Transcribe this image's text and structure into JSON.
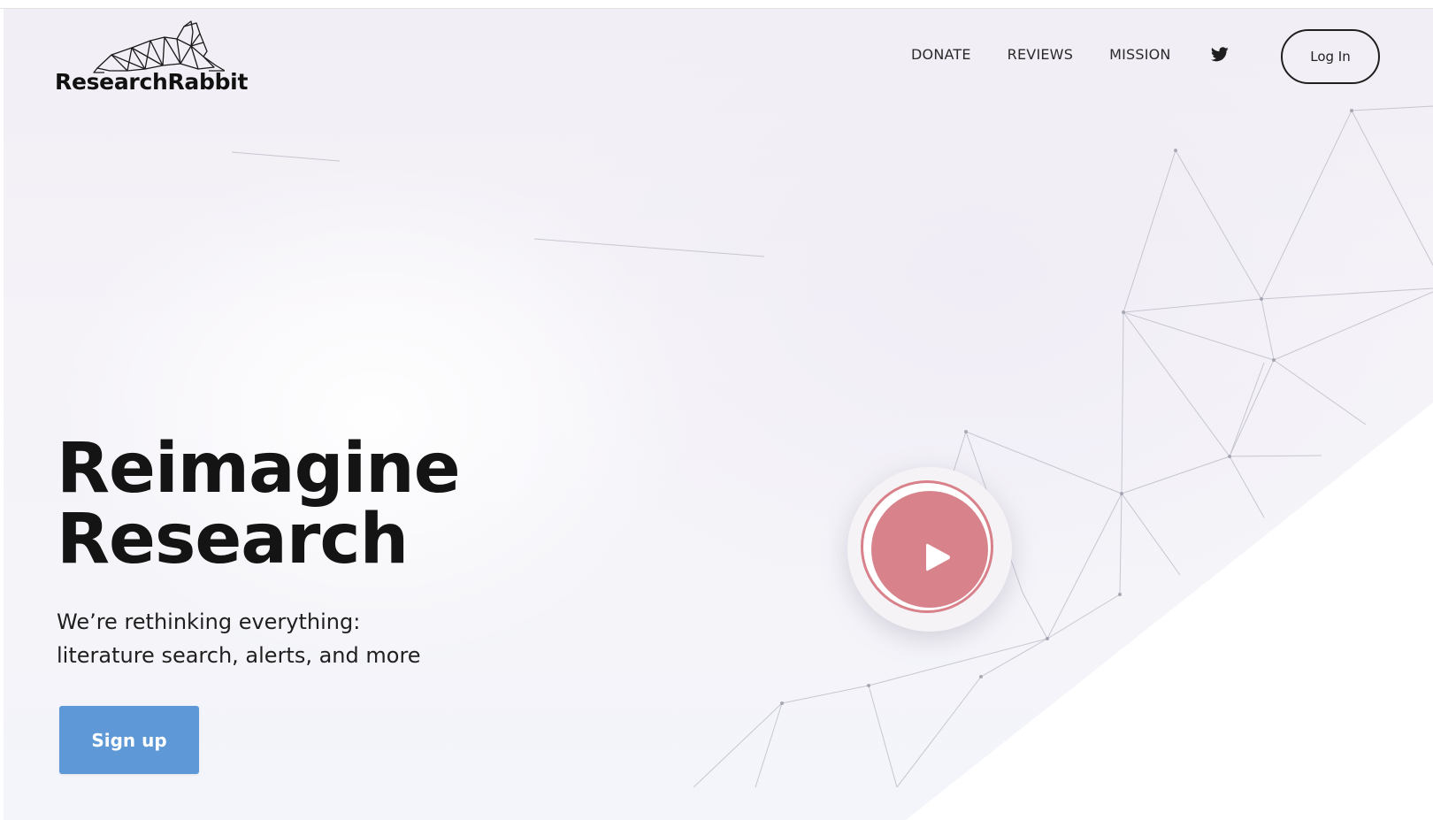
{
  "brand": {
    "name": "ResearchRabbit",
    "logo_icon": "rabbit-logo-icon"
  },
  "nav": {
    "items": [
      {
        "label": "DONATE"
      },
      {
        "label": "REVIEWS"
      },
      {
        "label": "MISSION"
      }
    ],
    "social_icon": "twitter-icon",
    "login_label": "Log In"
  },
  "hero": {
    "headline_line1": "Reimagine",
    "headline_line2": "Research",
    "sub_line1": "We’re rethinking everything:",
    "sub_line2": "literature search, alerts, and more",
    "signup_label": "Sign up",
    "video_icon": "play-icon"
  },
  "colors": {
    "signup_button": "#5f98d6",
    "play_button": "#d8838c",
    "text_dark": "#141414",
    "background": "#f3f1f7"
  }
}
